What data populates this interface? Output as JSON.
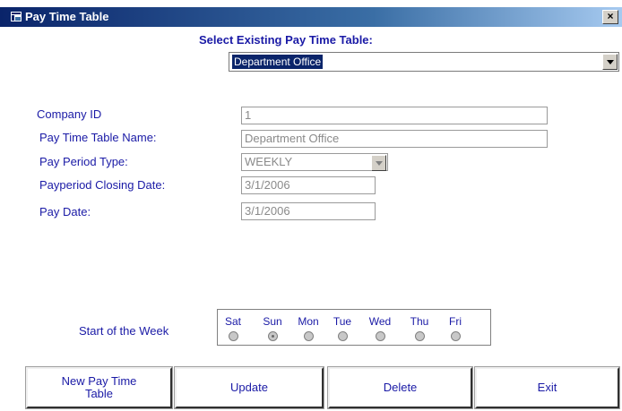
{
  "window": {
    "title": "Pay Time Table",
    "close_label": "×"
  },
  "selector": {
    "heading": "Select Existing Pay Time Table:",
    "selected": "Department Office"
  },
  "form": {
    "company_id_label": "Company ID",
    "company_id_value": "1",
    "name_label": "Pay Time Table Name:",
    "name_value": "Department Office",
    "period_type_label": "Pay Period Type:",
    "period_type_value": "WEEKLY",
    "closing_date_label": "Payperiod Closing Date:",
    "closing_date_value": "3/1/2006",
    "pay_date_label": "Pay Date:",
    "pay_date_value": "3/1/2006"
  },
  "week": {
    "label": "Start of the Week",
    "days": [
      "Sat",
      "Sun",
      "Mon",
      "Tue",
      "Wed",
      "Thu",
      "Fri"
    ],
    "selected_day": "Sun"
  },
  "buttons": {
    "new_label": "New Pay Time Table",
    "update_label": "Update",
    "delete_label": "Delete",
    "exit_label": "Exit"
  }
}
